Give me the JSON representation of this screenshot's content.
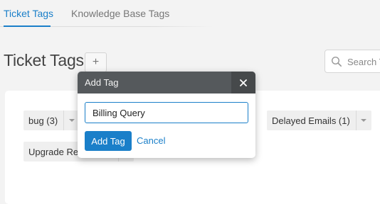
{
  "tabs": [
    {
      "label": "Ticket Tags",
      "active": true
    },
    {
      "label": "Knowledge Base Tags",
      "active": false
    }
  ],
  "page": {
    "title": "Ticket Tags",
    "add_label": "+"
  },
  "search": {
    "placeholder": "Search T"
  },
  "tags": [
    {
      "label": "bug  (3)"
    },
    {
      "label": "Delayed Emails  (1)"
    },
    {
      "label": "Upgrade Req"
    }
  ],
  "modal": {
    "title": "Add Tag",
    "close_label": "×",
    "input_value": "Billing Query",
    "submit_label": "Add Tag",
    "cancel_label": "Cancel"
  },
  "colors": {
    "accent": "#1a7fc9",
    "modal_header": "#55595c",
    "background": "#f3f3f3"
  },
  "icons": {
    "search": "search-icon",
    "close": "close-icon",
    "dropdown": "chevron-down-icon",
    "add": "plus-icon"
  }
}
